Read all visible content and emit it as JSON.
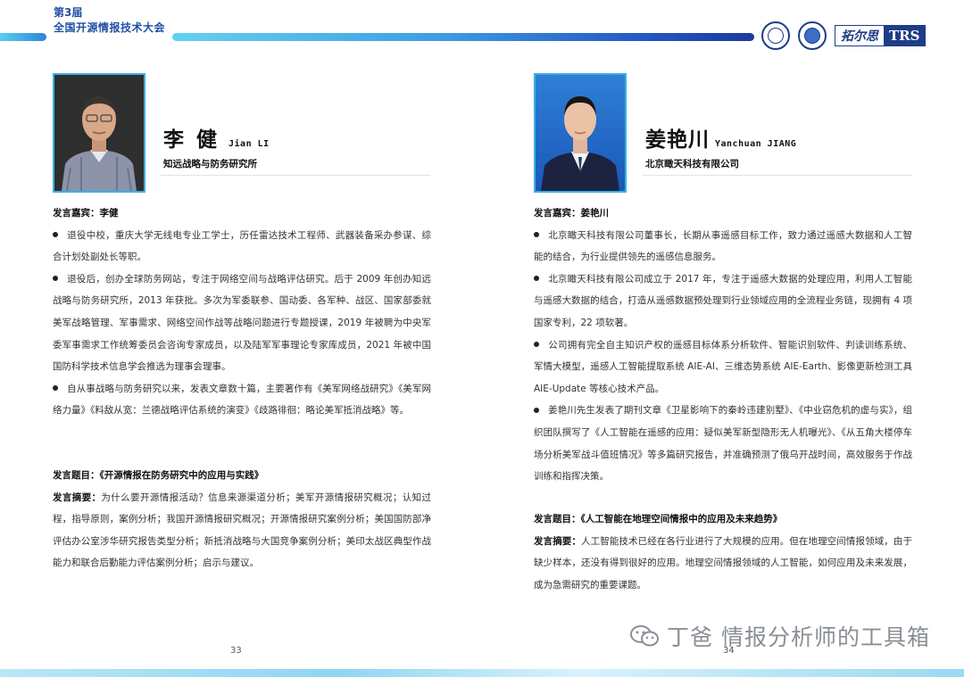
{
  "header": {
    "edition": "第3届",
    "conference": "全国开源情报技术大会",
    "logo_text": "拓尔思",
    "logo_badge": "TRS"
  },
  "left": {
    "name_cn": "李 健",
    "name_en": "Jian LI",
    "org": "知远战略与防务研究所",
    "speaker_label": "发言嘉宾：",
    "speaker_name": "李健",
    "bullets": [
      "退役中校，重庆大学无线电专业工学士，历任雷达技术工程师、武器装备采办参谋、综合计划处副处长等职。",
      "退役后，创办全球防务网站，专注于网络空间与战略评估研究。后于 2009 年创办知远战略与防务研究所，2013 年获批。多次为军委联参、国动委、各军种、战区、国家部委就美军战略管理、军事需求、网络空间作战等战略问题进行专题授课，2019 年被聘为中央军委军事需求工作统筹委员会咨询专家成员，以及陆军军事理论专家库成员，2021 年被中国国防科学技术信息学会推选为理事会理事。",
      "自从事战略与防务研究以来，发表文章数十篇，主要著作有《美军网络战研究》《美军网络力量》《料敌从宽：兰德战略评估系统的演变》《歧路徘徊：略论美军抵消战略》等。"
    ],
    "topic_label": "发言题目：",
    "topic": "《开源情报在防务研究中的应用与实践》",
    "abstract_label": "发言摘要：",
    "abstract": "为什么要开源情报活动？信息来源渠道分析；美军开源情报研究概况；认知过程，指导原则，案例分析；我国开源情报研究概况；开源情报研究案例分析；美国国防部净评估办公室涉华研究报告类型分析；新抵消战略与大国竞争案例分析；美印太战区典型作战能力和联合后勤能力评估案例分析；启示与建议。",
    "page": "33"
  },
  "right": {
    "name_cn": "姜艳川",
    "name_en": "Yanchuan JIANG",
    "org": "北京瞰天科技有限公司",
    "speaker_label": "发言嘉宾：",
    "speaker_name": "姜艳川",
    "bullets": [
      "北京瞰天科技有限公司董事长，长期从事遥感目标工作，致力通过遥感大数据和人工智能的结合，为行业提供领先的遥感信息服务。",
      "北京瞰天科技有限公司成立于 2017 年，专注于遥感大数据的处理应用，利用人工智能与遥感大数据的结合，打造从遥感数据预处理到行业领域应用的全流程业务链，现拥有 4 项国家专利，22 项软著。",
      "公司拥有完全自主知识产权的遥感目标体系分析软件、智能识别软件、判读训练系统、军情大模型，遥感人工智能提取系统 AIE-AI、三维态势系统 AIE-Earth、影像更新检测工具 AIE-Update 等核心技术产品。",
      "姜艳川先生发表了期刊文章《卫星影响下的秦岭违建别墅》、《中业窃危机的虚与实》，组织团队撰写了《人工智能在遥感的应用：疑似美军新型隐形无人机曝光》、《从五角大楼停车场分析美军战斗值班情况》等多篇研究报告，并准确预测了俄乌开战时间，高效服务于作战训练和指挥决策。"
    ],
    "topic_label": "发言题目：",
    "topic": "《人工智能在地理空间情报中的应用及未来趋势》",
    "abstract_label": "发言摘要：",
    "abstract": "人工智能技术已经在各行业进行了大规模的应用。但在地理空间情报领域，由于缺少样本，还没有得到很好的应用。地理空间情报领域的人工智能，如何应用及未来发展，成为急需研究的重要课题。",
    "page": "34"
  },
  "watermark": "丁爸 情报分析师的工具箱",
  "colors": {
    "brand_blue": "#1f4fa3",
    "accent_cyan": "#3aaee8",
    "dark_blue": "#1f3c88"
  }
}
